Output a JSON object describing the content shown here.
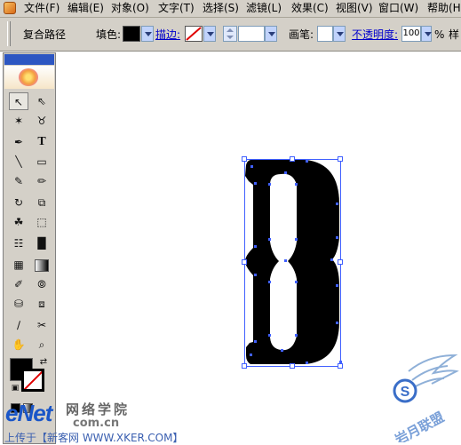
{
  "menu": [
    "文件(F)",
    "编辑(E)",
    "对象(O)",
    "文字(T)",
    "选择(S)",
    "滤镜(L)",
    "效果(C)",
    "视图(V)",
    "窗口(W)",
    "帮助(H)"
  ],
  "options": {
    "object_type": "复合路径",
    "fill_label": "填色:",
    "stroke_label": "描边:",
    "brush_label": "画笔:",
    "opacity_label": "不透明度:",
    "opacity_value": "100",
    "percent": "%",
    "style_label": "样"
  },
  "colors": {
    "fill": "#000000",
    "stroke": "none",
    "selection": "#4060ff"
  },
  "toolbox": {
    "icons": [
      "selection-tool-icon",
      "direct-selection-tool-icon",
      "magic-wand-tool-icon",
      "lasso-tool-icon",
      "pen-tool-icon",
      "type-tool-icon",
      "line-segment-tool-icon",
      "rectangle-tool-icon",
      "paintbrush-tool-icon",
      "pencil-tool-icon",
      "rotate-tool-icon",
      "scale-tool-icon",
      "warp-tool-icon",
      "free-transform-tool-icon",
      "symbol-sprayer-tool-icon",
      "column-graph-tool-icon",
      "mesh-tool-icon",
      "gradient-tool-icon",
      "eyedropper-tool-icon",
      "blend-tool-icon",
      "live-paint-bucket-tool-icon",
      "live-paint-selection-tool-icon",
      "slice-tool-icon",
      "scissors-tool-icon",
      "hand-tool-icon",
      "zoom-tool-icon"
    ]
  },
  "watermark": {
    "brand": "eNet",
    "brand_cn": "网络学院",
    "domain": "com.cn",
    "footer": "上传于【新客网 WWW.XKER.COM】",
    "logo_text": "岩月联盟",
    "logo_letter": "S"
  }
}
